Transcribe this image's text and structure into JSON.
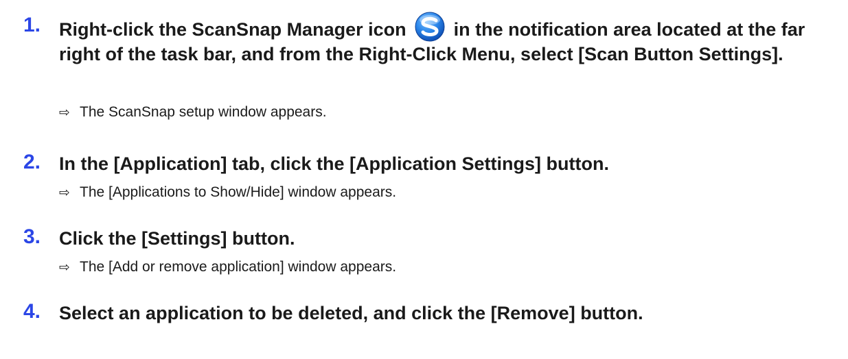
{
  "steps": [
    {
      "number": "1.",
      "text_before_icon": "Right-click the ScanSnap Manager icon",
      "icon": "scansnap-manager-icon",
      "text_after_icon": "in the notification area located at the far right of the task bar, and from the Right-Click Menu, select [Scan Button Settings].",
      "result": "The ScanSnap setup window appears."
    },
    {
      "number": "2.",
      "text": "In the [Application] tab, click the [Application Settings] button.",
      "result": "The [Applications to Show/Hide] window appears."
    },
    {
      "number": "3.",
      "text": "Click the [Settings] button.",
      "result": "The [Add or remove application] window appears."
    },
    {
      "number": "4.",
      "text": "Select an application to be deleted, and click the [Remove] button."
    }
  ],
  "result_arrow": "⇨",
  "colors": {
    "step_number": "#2b46e6",
    "text": "#1a1a1a",
    "icon_blue": "#1e6fd9"
  }
}
